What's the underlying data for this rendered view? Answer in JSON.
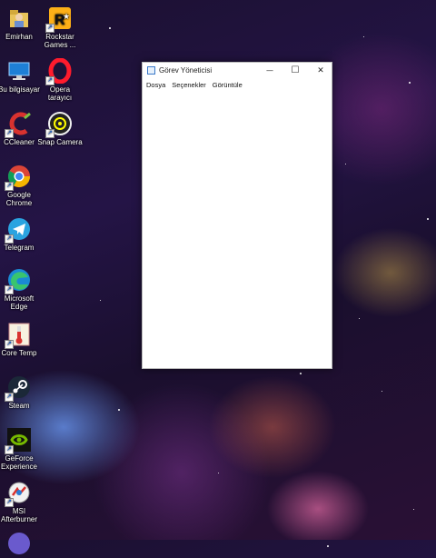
{
  "desktop": {
    "icons": [
      {
        "id": "emirhan",
        "label": "Emirhan",
        "icon": "user-folder-icon"
      },
      {
        "id": "rockstar",
        "label": "Rockstar Games ...",
        "icon": "rockstar-icon"
      },
      {
        "id": "bu-bilgisayar",
        "label": "Bu bilgisayar",
        "icon": "computer-icon"
      },
      {
        "id": "opera",
        "label": "Opera tarayıcı",
        "icon": "opera-icon"
      },
      {
        "id": "ccleaner",
        "label": "CCleaner",
        "icon": "ccleaner-icon"
      },
      {
        "id": "snap-camera",
        "label": "Snap Camera",
        "icon": "snap-camera-icon"
      },
      {
        "id": "google-chrome",
        "label": "Google Chrome",
        "icon": "chrome-icon"
      },
      {
        "id": "telegram",
        "label": "Telegram",
        "icon": "telegram-icon"
      },
      {
        "id": "microsoft-edge",
        "label": "Microsoft Edge",
        "icon": "edge-icon"
      },
      {
        "id": "core-temp",
        "label": "Core Temp",
        "icon": "thermometer-icon"
      },
      {
        "id": "steam",
        "label": "Steam",
        "icon": "steam-icon"
      },
      {
        "id": "geforce",
        "label": "GeForce Experience",
        "icon": "nvidia-icon"
      },
      {
        "id": "msi",
        "label": "MSI Afterburner",
        "icon": "msi-afterburner-icon"
      }
    ]
  },
  "window": {
    "title": "Görev Yöneticisi",
    "minimize_glyph": "—",
    "maximize_glyph": "☐",
    "close_glyph": "✕",
    "menu": [
      "Dosya",
      "Seçenekler",
      "Görüntüle"
    ]
  }
}
